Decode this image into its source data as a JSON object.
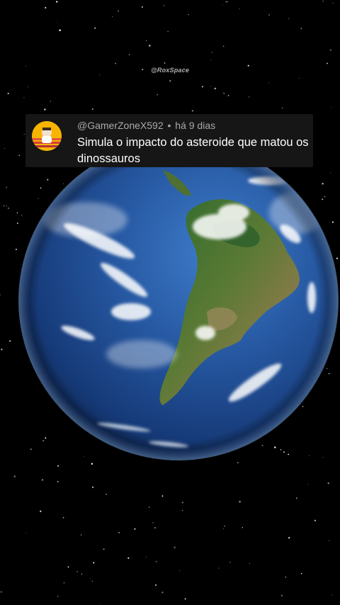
{
  "watermark": "@RoxSpace",
  "comment": {
    "username": "@GamerZoneX592",
    "separator": "•",
    "time": "há 9 dias",
    "text": "Simula o impacto do asteroide que matou os dinossauros"
  },
  "colors": {
    "background": "#000000",
    "card": "#161616",
    "meta_text": "#aaaaaa",
    "body_text": "#ffffff",
    "ocean": "#1f4f9a",
    "land": "#4c6e2e"
  },
  "scene": "earth-from-space"
}
